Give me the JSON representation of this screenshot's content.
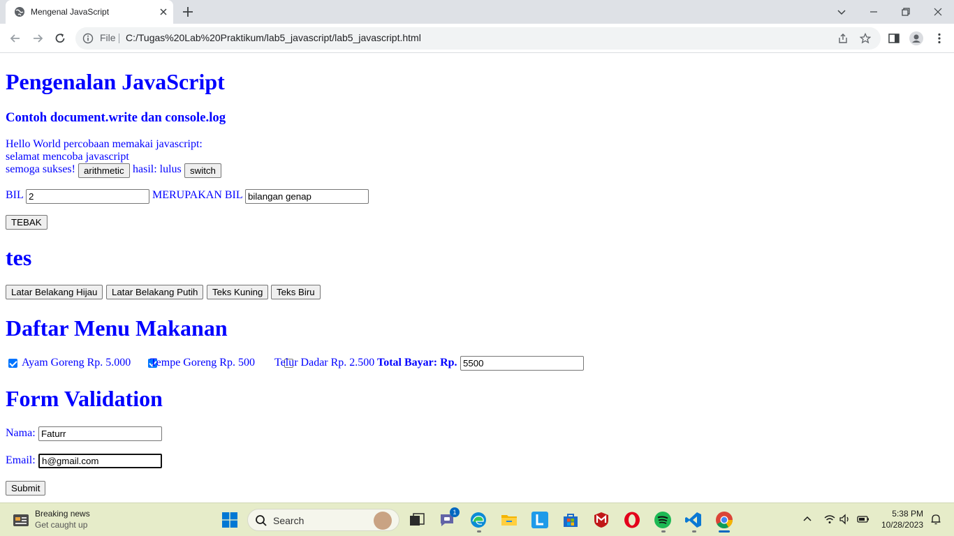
{
  "browser": {
    "tab_title": "Mengenal JavaScript",
    "scheme_label": "File",
    "url": "C:/Tugas%20Lab%20Praktikum/lab5_javascript/lab5_javascript.html"
  },
  "page": {
    "heading_main": "Pengenalan JavaScript",
    "subheading": "Contoh document.write dan console.log",
    "line1": "Hello World percobaan memakai javascript:",
    "line2": "selamat mencoba javascript",
    "line3": "semoga sukses!",
    "arithmetic_button": "arithmetic",
    "hasil_text": "hasil: lulus",
    "switch_button": "switch",
    "bil_label": "BIL",
    "bil_value": "2",
    "merupakan_label": "MERUPAKAN BIL",
    "result_value": "bilangan genap",
    "tebak_button": "TEBAK",
    "heading_tes": "tes",
    "color_buttons": [
      "Latar Belakang Hijau",
      "Latar Belakang Putih",
      "Teks Kuning",
      "Teks Biru"
    ],
    "heading_menu": "Daftar Menu Makanan",
    "menu_items": [
      {
        "label": "Ayam Goreng Rp. 5.000",
        "checked": true
      },
      {
        "label": "Tempe Goreng Rp. 500",
        "checked": true
      },
      {
        "label": "Telur Dadar Rp. 2.500",
        "checked": false
      }
    ],
    "total_label": "Total Bayar: Rp.",
    "total_value": "5500",
    "heading_form": "Form Validation",
    "nama_label": "Nama:",
    "nama_value": "Faturr",
    "email_label": "Email:",
    "email_value": "h@gmail.com",
    "submit_button": "Submit"
  },
  "taskbar": {
    "news_title": "Breaking news",
    "news_subtitle": "Get caught up",
    "search_placeholder": "Search",
    "chat_badge": "1",
    "time": "5:38 PM",
    "date": "10/28/2023"
  },
  "colors": {
    "page_text": "#0000ff",
    "tab_strip": "#dee1e6",
    "taskbar": "#e6ecc9",
    "accent": "#0067c0"
  }
}
